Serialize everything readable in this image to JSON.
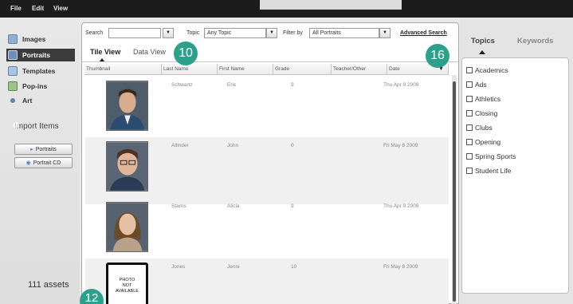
{
  "menu": [
    "File",
    "Edit",
    "View"
  ],
  "sidebar": {
    "items": [
      {
        "label": "Images",
        "icon": "images-icon",
        "active": false
      },
      {
        "label": "Portraits",
        "icon": "portraits-icon",
        "active": true
      },
      {
        "label": "Templates",
        "icon": "templates-icon",
        "active": false
      },
      {
        "label": "Pop-ins",
        "icon": "popins-icon",
        "active": false
      },
      {
        "label": "Art",
        "icon": "art-icon",
        "active": false
      }
    ],
    "import_title": "Import Items",
    "import_buttons": [
      "Portraits",
      "Portrait CD"
    ],
    "assets_count": "111 assets"
  },
  "toolbar": {
    "search_label": "Search",
    "search_value": "",
    "topic_label": "Topic",
    "topic_value": "Any Topic",
    "filter_label": "Filter by",
    "filter_value": "All Portraits",
    "advanced_search": "Advanced Search"
  },
  "tabs": [
    "Tile View",
    "Data View"
  ],
  "columns": [
    "Thumbnail",
    "Last Name",
    "First Name",
    "Grade",
    "Teacher/Other",
    "Date"
  ],
  "rows": [
    {
      "last": "Schwartz",
      "first": "Eric",
      "grade": "9",
      "teacher": "",
      "date": "Thu Apr 9 2009"
    },
    {
      "last": "Allinder",
      "first": "John",
      "grade": "0",
      "teacher": "",
      "date": "Fri May 8 2009"
    },
    {
      "last": "Starns",
      "first": "Alicia",
      "grade": "9",
      "teacher": "",
      "date": "Thu Apr 9 2009"
    },
    {
      "last": "Jones",
      "first": "Jenni",
      "grade": "10",
      "teacher": "",
      "date": "Fri May 8 2009"
    }
  ],
  "photo_not_available": [
    "PHOTO",
    "NOT",
    "AVAILABLE"
  ],
  "right_panel": {
    "tabs": [
      "Topics",
      "Keywords"
    ],
    "topics": [
      "Academics",
      "Ads",
      "Athletics",
      "Closing",
      "Clubs",
      "Opening",
      "Spring Sports",
      "Student Life"
    ]
  },
  "callouts": [
    "10",
    "16",
    "12"
  ],
  "colors": {
    "callout": "#2ba18b",
    "active_nav": "#3b3b3b",
    "menubar": "#1c1c1c"
  }
}
